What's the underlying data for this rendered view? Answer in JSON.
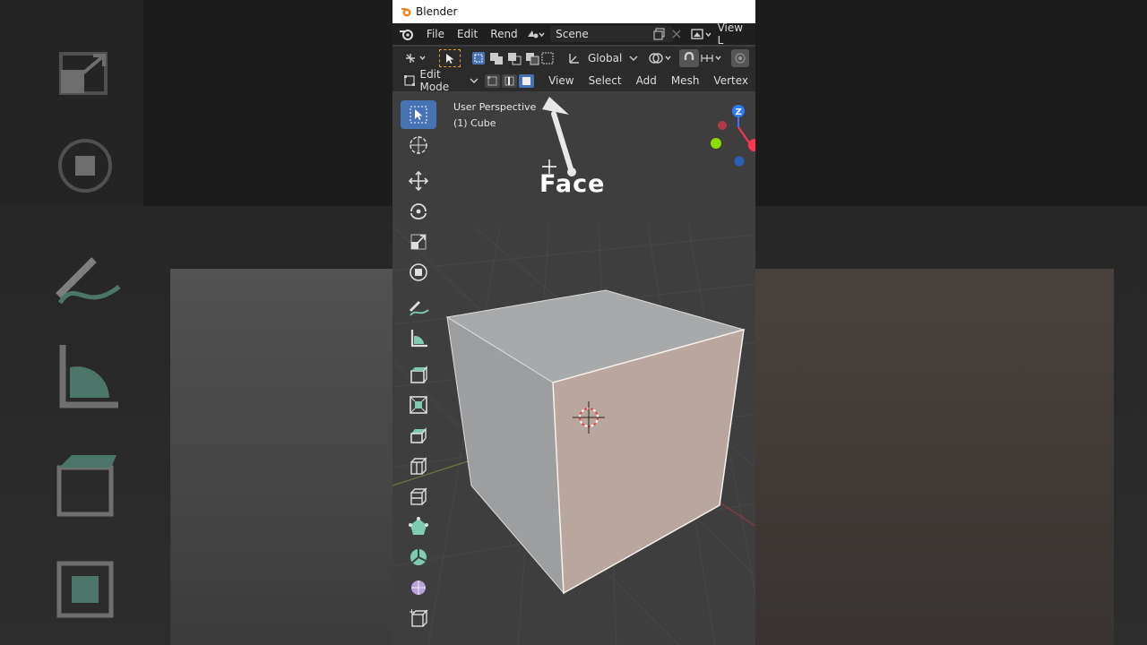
{
  "window": {
    "title": "Blender"
  },
  "menu": {
    "items": [
      "File",
      "Edit",
      "Rend"
    ],
    "scene": "Scene",
    "view_layer": "View L"
  },
  "toolbar": {
    "transform_orientation": "Global"
  },
  "header": {
    "mode": "Edit Mode",
    "menu_items": [
      "View",
      "Select",
      "Add",
      "Mesh",
      "Vertex"
    ]
  },
  "viewport": {
    "perspective": "User Perspective",
    "object": "(1) Cube"
  },
  "annotation": {
    "label": "Face"
  },
  "colors": {
    "active_tool": "#4772b3",
    "face_select": "#b9a79f",
    "axis_z": "#2e7bff",
    "axis_x": "#ff3352",
    "axis_y": "#8bdc00"
  }
}
